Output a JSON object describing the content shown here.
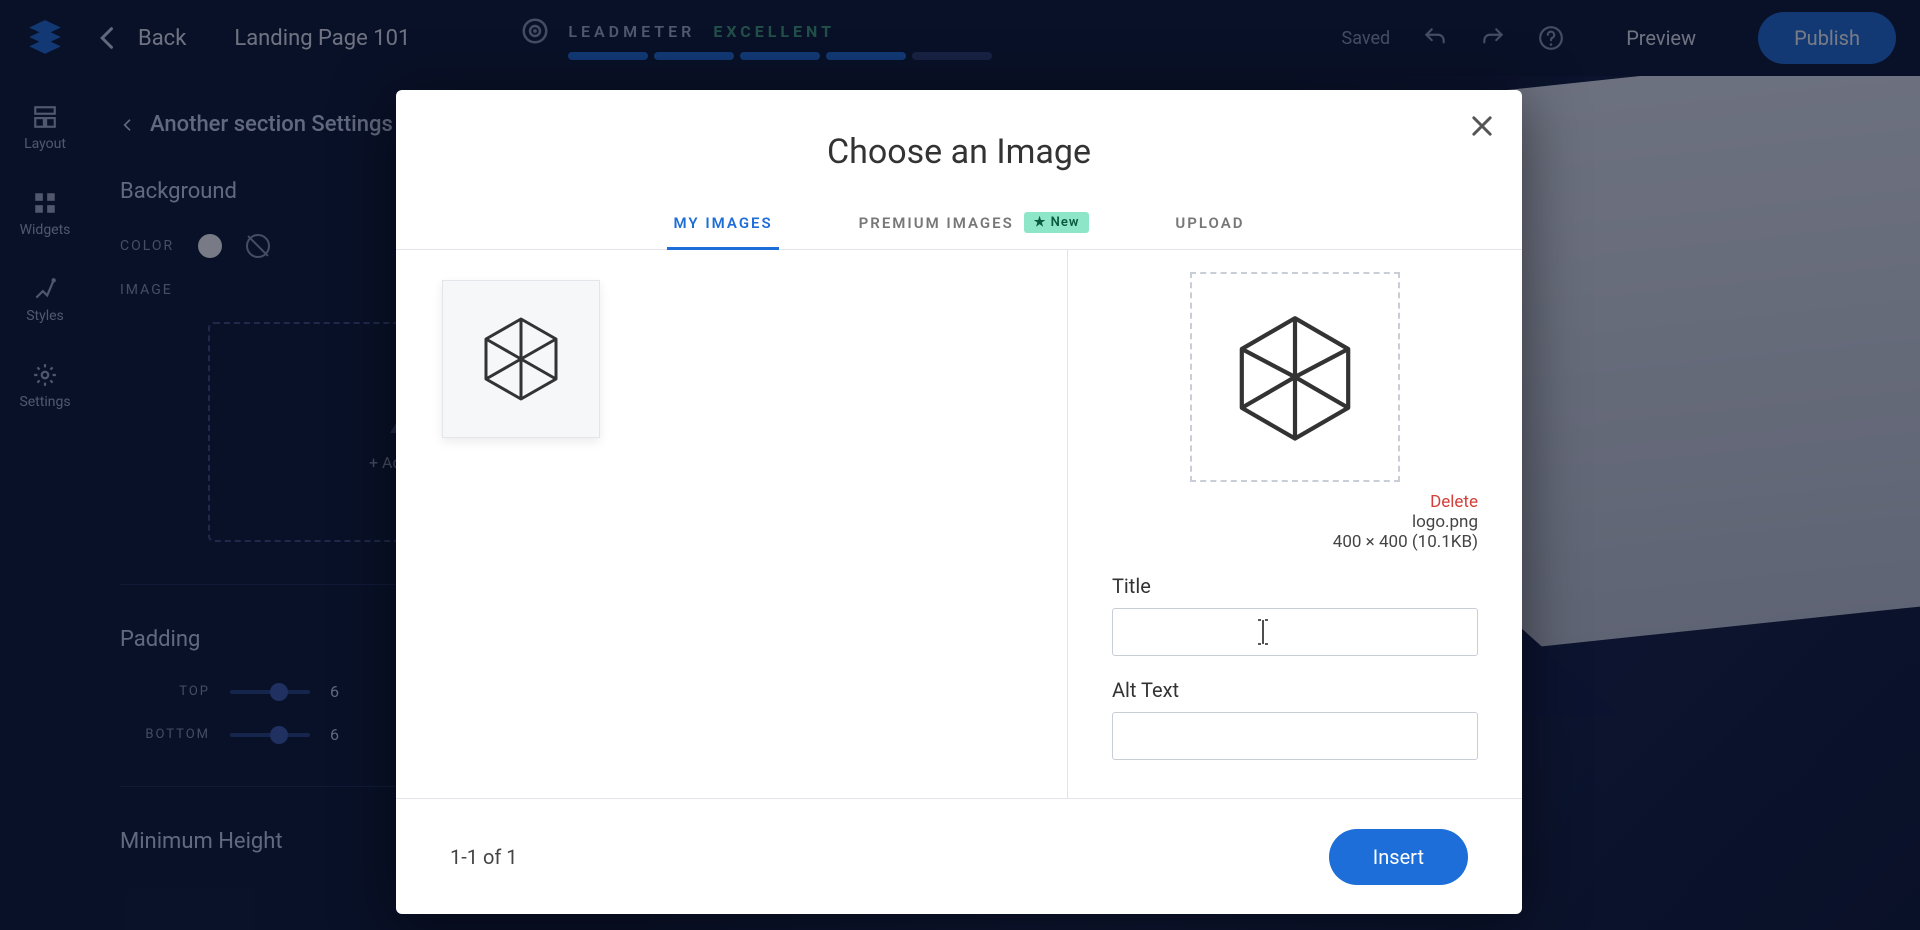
{
  "topbar": {
    "back_label": "Back",
    "page_title": "Landing Page 101",
    "leadmeter_label": "LEADMETER",
    "leadmeter_status": "EXCELLENT",
    "saved_label": "Saved",
    "preview_label": "Preview",
    "publish_label": "Publish"
  },
  "rail": {
    "items": [
      "Layout",
      "Widgets",
      "Styles",
      "Settings"
    ]
  },
  "panel": {
    "breadcrumb": "Another section Settings",
    "background_title": "Background",
    "color_label": "COLOR",
    "image_label": "IMAGE",
    "add_image_label": "+ Add Image",
    "padding_title": "Padding",
    "top_label": "TOP",
    "top_value": "6",
    "bottom_label": "BOTTOM",
    "bottom_value": "6",
    "min_height_title": "Minimum Height"
  },
  "modal": {
    "title": "Choose an Image",
    "tabs": {
      "my_images": "MY IMAGES",
      "premium_images": "PREMIUM IMAGES",
      "new_chip": "★ New",
      "upload": "UPLOAD"
    },
    "detail": {
      "delete_label": "Delete",
      "filename": "logo.png",
      "dimensions": "400 × 400 (10.1KB)",
      "title_label": "Title",
      "title_value": "",
      "alt_label": "Alt Text",
      "alt_value": ""
    },
    "footer": {
      "pagination": "1-1 of 1",
      "insert_label": "Insert"
    }
  }
}
